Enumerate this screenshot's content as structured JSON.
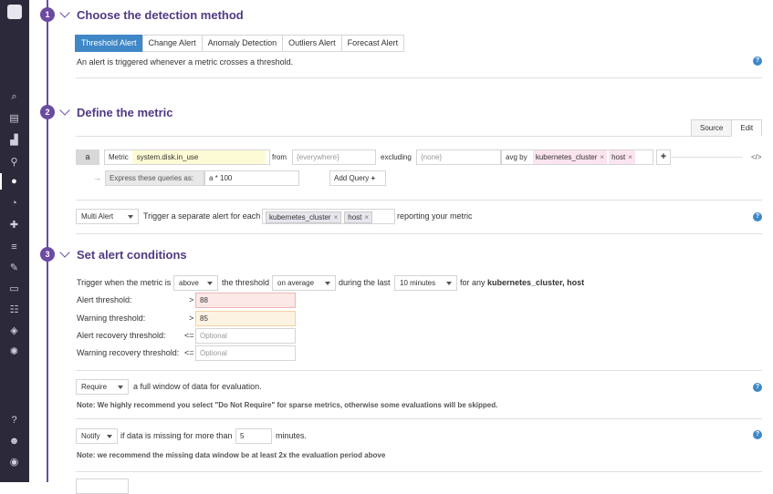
{
  "colors": {
    "accent": "#6b4ba1",
    "primary": "#3f87c7",
    "sidebar": "#2c2a3a",
    "metric_bg": "#fdfbd5",
    "alert_bg": "#fde8e8",
    "warn_bg": "#fdf3e3"
  },
  "sidebar": {
    "icons": [
      "binoculars-icon",
      "dashboard-icon",
      "chart-icon",
      "network-icon",
      "monitor-alert-icon",
      "apm-icon",
      "puzzle-icon",
      "logs-icon",
      "wrench-icon",
      "notebook-icon",
      "synthetics-icon",
      "security-icon",
      "ci-icon",
      "help-icon",
      "team-icon",
      "account-icon"
    ]
  },
  "step1": {
    "number": "1",
    "title": "Choose the detection method",
    "tabs": [
      "Threshold Alert",
      "Change Alert",
      "Anomaly Detection",
      "Outliers Alert",
      "Forecast Alert"
    ],
    "description": "An alert is triggered whenever a metric crosses a threshold."
  },
  "step2": {
    "number": "2",
    "title": "Define the metric",
    "source_tab": "Source",
    "edit_tab": "Edit",
    "query_letter": "a",
    "metric_label": "Metric",
    "metric_value": "system.disk.in_use",
    "from_label": "from",
    "from_placeholder": "{everywhere}",
    "excluding_label": "excluding",
    "excluding_placeholder": "{none}",
    "avg_by_label": "avg by",
    "avg_by_tags": [
      "kubernetes_cluster",
      "host"
    ],
    "express_arrow": "→",
    "express_label": "Express these queries as:",
    "express_value": "a * 100",
    "add_query": "Add Query",
    "multi_alert": "Multi Alert",
    "trigger_text": "Trigger a separate alert for each",
    "trigger_tags": [
      "kubernetes_cluster",
      "host"
    ],
    "reporting_text": "reporting your metric"
  },
  "step3": {
    "number": "3",
    "title": "Set alert conditions",
    "trigger_when": "Trigger when the metric is",
    "comparator": "above",
    "the_threshold": "the threshold",
    "aggregation": "on average",
    "during_last": "during the last",
    "window": "10 minutes",
    "for_any": "for any",
    "for_any_keys": "kubernetes_cluster, host",
    "alert_threshold_label": "Alert threshold:",
    "alert_op": ">",
    "alert_value": "88",
    "warning_threshold_label": "Warning threshold:",
    "warning_op": ">",
    "warning_value": "85",
    "alert_recovery_label": "Alert recovery threshold:",
    "alert_recovery_op": "<=",
    "alert_recovery_placeholder": "Optional",
    "warning_recovery_label": "Warning recovery threshold:",
    "warning_recovery_op": "<=",
    "warning_recovery_placeholder": "Optional",
    "require_value": "Require",
    "require_text": "a full window of data for evaluation.",
    "require_note": "Note: We highly recommend you select \"Do Not Require\" for sparse metrics, otherwise some evaluations will be skipped.",
    "notify_value": "Notify",
    "missing_text": "if data is missing for more than",
    "missing_value": "5",
    "minutes_text": "minutes.",
    "missing_note": "Note: we recommend the missing data window be at least 2x the evaluation period above"
  }
}
